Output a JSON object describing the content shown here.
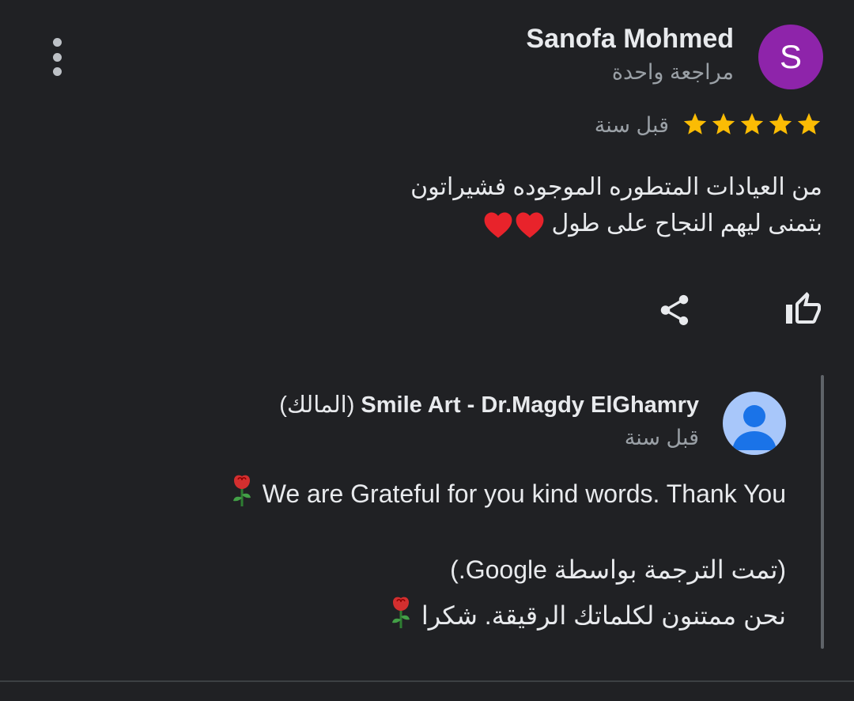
{
  "review": {
    "reviewer_initial": "S",
    "reviewer_name": "Sanofa Mohmed",
    "reviewer_review_count": "مراجعة واحدة",
    "rating": 5,
    "rating_max": 5,
    "time_ago": "قبل سنة",
    "text_line_1": "من العيادات المتطوره الموجوده فشيراتون",
    "text_line_2": "بتمنى ليهم النجاح على طول",
    "emoji": "red-heart x2",
    "avatar_color": "#8e24aa",
    "star_color": "#fbbc04"
  },
  "actions": {
    "share_icon": "share-icon",
    "like_icon": "thumb-up-outline-icon",
    "more_icon": "more-vertical-icon"
  },
  "owner_reply": {
    "owner_name": "Smile Art - Dr.Magdy ElGhamry",
    "owner_tag": "(المالك)",
    "time_ago": "قبل سنة",
    "text_en": "We are Grateful for you kind words. Thank You",
    "translation_note": "(تمت الترجمة بواسطة Google.)",
    "text_ar": "نحن ممتنون لكلماتك الرقيقة. شكرا",
    "emoji": "rose",
    "avatar_color": "#a8c7fa",
    "avatar_icon": "default-person-icon"
  },
  "theme": {
    "background": "#202124",
    "text_primary": "#e8eaed",
    "text_secondary": "#9aa0a6"
  }
}
